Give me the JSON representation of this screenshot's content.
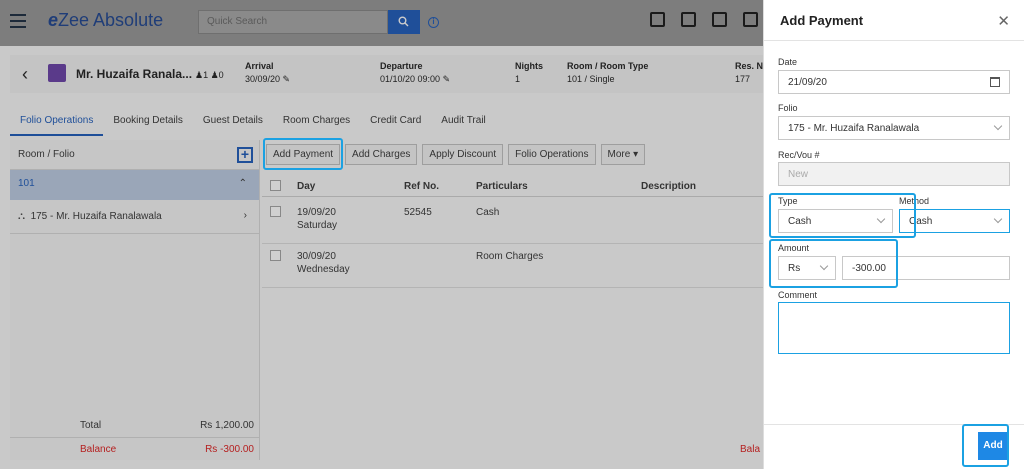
{
  "app": {
    "logo_prefix": "e",
    "logo_rest": "Zee Absolute"
  },
  "search": {
    "placeholder": "Quick Search"
  },
  "reservation": {
    "guest": "Mr. Huzaifa Ranala...",
    "adults": "1",
    "children": "0",
    "arrival_label": "Arrival",
    "arrival": "30/09/20",
    "departure_label": "Departure",
    "departure": "01/10/20 09:00",
    "nights_label": "Nights",
    "nights": "1",
    "room_type_label": "Room / Room Type",
    "room_type": "101 / Single",
    "res_no_label": "Res. N",
    "res_no": "177"
  },
  "tabs": [
    "Folio Operations",
    "Booking Details",
    "Guest Details",
    "Room Charges",
    "Credit Card",
    "Audit Trail"
  ],
  "left_panel": {
    "header": "Room / Folio",
    "room": "101",
    "folio": "175 - Mr. Huzaifa Ranalawala",
    "total_label": "Total",
    "total_value": "Rs 1,200.00",
    "balance_label": "Balance",
    "balance_value": "Rs -300.00"
  },
  "actions": [
    "Add Payment",
    "Add Charges",
    "Apply Discount",
    "Folio Operations",
    "More"
  ],
  "grid": {
    "headers": {
      "day": "Day",
      "ref": "Ref No.",
      "particulars": "Particulars",
      "description": "Description"
    },
    "rows": [
      {
        "date": "19/09/20",
        "weekday": "Saturday",
        "ref": "52545",
        "particulars": "Cash"
      },
      {
        "date": "30/09/20",
        "weekday": "Wednesday",
        "ref": "",
        "particulars": "Room Charges"
      }
    ],
    "balance_partial": "Bala"
  },
  "modal": {
    "title": "Add Payment",
    "date_label": "Date",
    "date": "21/09/20",
    "folio_label": "Folio",
    "folio": "175 - Mr. Huzaifa Ranalawala",
    "recvou_label": "Rec/Vou #",
    "recvou_placeholder": "New",
    "type_label": "Type",
    "type": "Cash",
    "method_label": "Method",
    "method": "Cash",
    "amount_label": "Amount",
    "currency": "Rs",
    "amount": "-300.00",
    "comment_label": "Comment",
    "add_label": "Add"
  },
  "colors": {
    "accent": "#1e88e5",
    "highlight": "#1ba1e2",
    "brand": "#1f4f99",
    "negative": "#b52020"
  }
}
